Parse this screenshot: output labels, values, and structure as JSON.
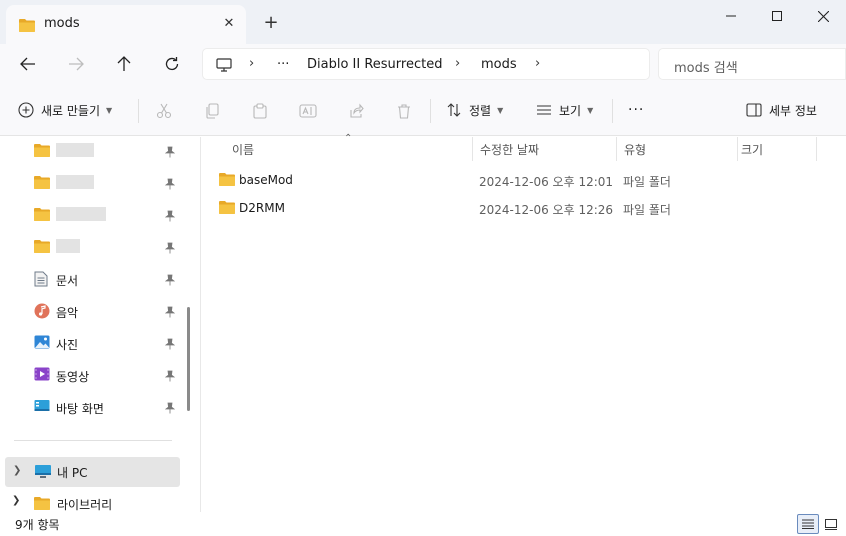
{
  "tab": {
    "title": "mods",
    "close": "✕",
    "new": "+"
  },
  "window": {
    "minimize": "—",
    "maximize": "☐",
    "close": "✕"
  },
  "address": {
    "overflow": "···",
    "crumbs": [
      "Diablo II Resurrected",
      "mods"
    ],
    "search_placeholder": "mods 검색"
  },
  "commands": {
    "new_label": "새로 만들기",
    "sort_label": "정렬",
    "view_label": "보기",
    "more": "···",
    "details_label": "세부 정보"
  },
  "sidebar": {
    "pinned": [
      {
        "label": "문서",
        "icon": "document-icon"
      },
      {
        "label": "음악",
        "icon": "music-icon"
      },
      {
        "label": "사진",
        "icon": "picture-icon"
      },
      {
        "label": "동영상",
        "icon": "video-icon"
      },
      {
        "label": "바탕 화면",
        "icon": "desktop-icon"
      }
    ],
    "my_pc": "내 PC",
    "library": "라이브러리"
  },
  "columns": {
    "name": "이름",
    "date": "수정한 날짜",
    "type": "유형",
    "size": "크기"
  },
  "files": [
    {
      "name": "baseMod",
      "date": "2024-12-06 오후 12:01",
      "type": "파일 폴더"
    },
    {
      "name": "D2RMM",
      "date": "2024-12-06 오후 12:26",
      "type": "파일 폴더"
    }
  ],
  "status": {
    "count": "9개 항목"
  },
  "colors": {
    "folder": "#f5c342",
    "folder_dark": "#e8a928",
    "accent": "#005fb8"
  }
}
